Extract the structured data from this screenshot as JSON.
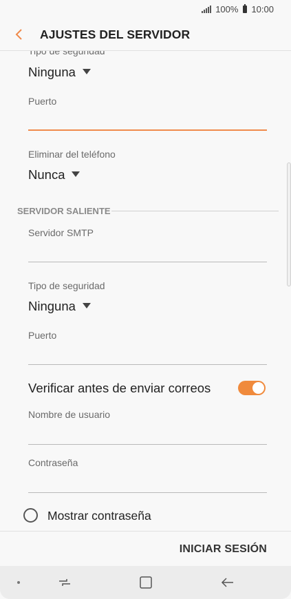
{
  "status_bar": {
    "battery": "100%",
    "time": "10:00"
  },
  "header": {
    "title": "AJUSTES DEL SERVIDOR"
  },
  "incoming": {
    "security_label": "Tipo de seguridad",
    "security_value": "Ninguna",
    "port_label": "Puerto",
    "port_value": "",
    "delete_label": "Eliminar del teléfono",
    "delete_value": "Nunca"
  },
  "outgoing": {
    "section_title": "SERVIDOR SALIENTE",
    "smtp_label": "Servidor SMTP",
    "smtp_value": "",
    "security_label": "Tipo de seguridad",
    "security_value": "Ninguna",
    "port_label": "Puerto",
    "port_value": "",
    "verify_label": "Verificar antes de enviar correos",
    "verify_enabled": true,
    "username_label": "Nombre de usuario",
    "username_value": "",
    "password_label": "Contraseña",
    "password_value": "",
    "show_password_label": "Mostrar contraseña"
  },
  "footer": {
    "login_label": "INICIAR SESIÓN"
  },
  "colors": {
    "accent": "#f08a3c",
    "background": "#f8f8f8"
  },
  "icons": [
    "signal-icon",
    "battery-icon",
    "back-icon",
    "dropdown-caret-icon",
    "recent-apps-icon",
    "home-icon",
    "back-nav-icon"
  ]
}
